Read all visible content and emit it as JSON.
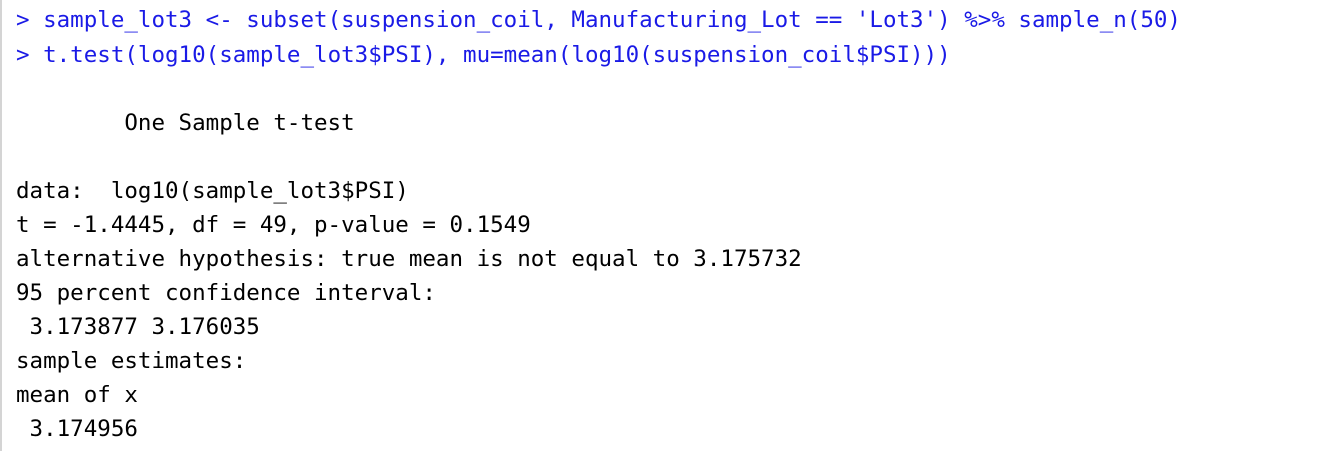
{
  "console": {
    "commands": [
      {
        "prompt": "> ",
        "text": "sample_lot3 <- subset(suspension_coil, Manufacturing_Lot == 'Lot3') %>% sample_n(50)"
      },
      {
        "prompt": "> ",
        "text": "t.test(log10(sample_lot3$PSI), mu=mean(log10(suspension_coil$PSI)))"
      }
    ],
    "output": {
      "title": "        One Sample t-test",
      "data_line": "data:  log10(sample_lot3$PSI)",
      "stats_line": "t = -1.4445, df = 49, p-value = 0.1549",
      "alternative_line": "alternative hypothesis: true mean is not equal to 3.175732",
      "ci_header": "95 percent confidence interval:",
      "ci_values": " 3.173877 3.176035",
      "estimates_header": "sample estimates:",
      "estimate_label": "mean of x",
      "estimate_value": " 3.174956"
    },
    "colors": {
      "command": "#1a1ae6",
      "output": "#000000",
      "background": "#ffffff"
    }
  }
}
